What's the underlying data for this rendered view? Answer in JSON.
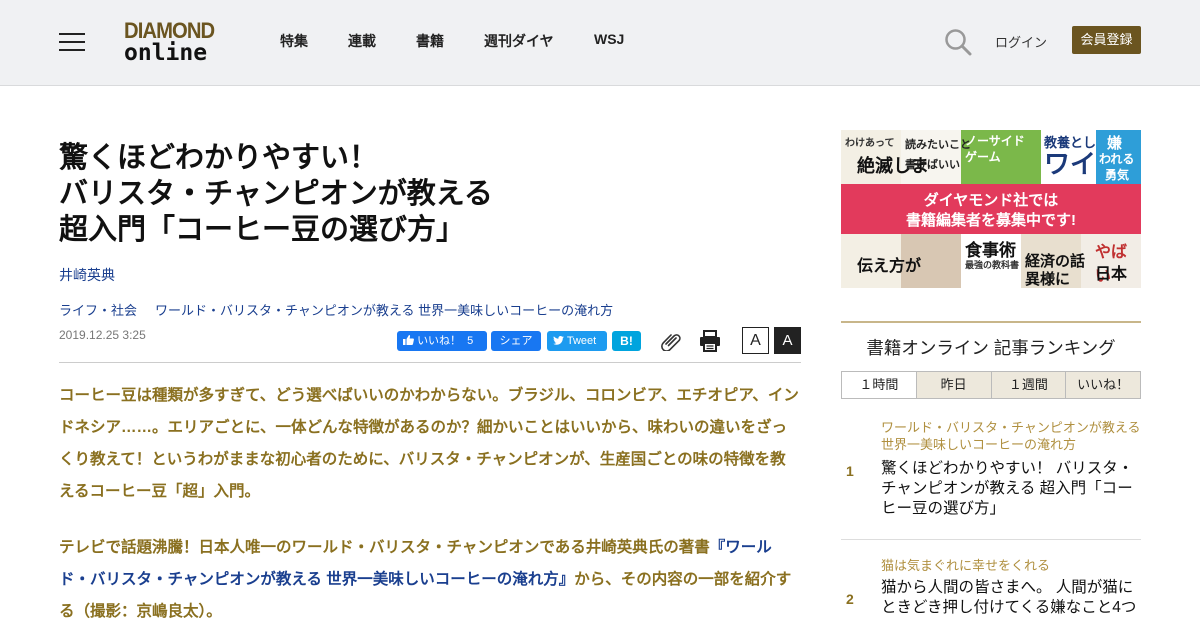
{
  "header": {
    "logo_top": "DIAMOND",
    "logo_bottom": "online",
    "nav": [
      "特集",
      "連載",
      "書籍",
      "週刊ダイヤ",
      "WSJ"
    ],
    "login": "ログイン",
    "register": "会員登録"
  },
  "article": {
    "title_lines": [
      "驚くほどわかりやすい！",
      "バリスタ・チャンピオンが教える",
      "超入門「コーヒー豆の選び方」"
    ],
    "author": "井崎英典",
    "breadcrumb": [
      "ライフ・社会",
      "ワールド・バリスタ・チャンピオンが教える 世界一美味しいコーヒーの淹れ方"
    ],
    "date": "2019.12.25 3:25",
    "share": {
      "like_label": "いいね！",
      "like_count": "5",
      "share_label": "シェア",
      "tweet_label": "Tweet",
      "hatena_label": "B!"
    },
    "font_small": "A",
    "font_large": "A",
    "lead": "コーヒー豆は種類が多すぎて、どう選べばいいのかわからない。ブラジル、コロンビア、エチオピア、インドネシア……。エリアごとに、一体どんな特徴があるのか？細かいことはいいから、味わいの違いをざっくり教えて！というわがままな初心者のために、バリスタ・チャンピオンが、生産国ごとの味の特徴を教えるコーヒー豆「超」入門。",
    "lead2_before": "テレビで話題沸騰！日本人唯一のワールド・バリスタ・チャンピオンである井崎英典氏の著書",
    "lead2_link": "『ワールド・バリスタ・チャンピオンが教える 世界一美味しいコーヒーの淹れ方』",
    "lead2_after": "から、その内容の一部を紹介する（撮影：京嶋良太）。"
  },
  "banner": {
    "line1": "ダイヤモンド社では",
    "line2": "書籍編集者を募集中です!",
    "book_texts": [
      "わけあって",
      "絶滅しま",
      "読みたいこと",
      "書けばいい",
      "ノーサイド",
      "ゲーム",
      "教養とし",
      "ワイ",
      "嫌",
      "われる",
      "勇気",
      "伝え方が",
      "食事術",
      "最強の教科書",
      "経済の話",
      "異様に",
      "やばい",
      "日本史"
    ]
  },
  "ranking": {
    "title": "書籍オンライン 記事ランキング",
    "tabs": [
      "１時間",
      "昨日",
      "１週間",
      "いいね！"
    ],
    "items": [
      {
        "rank": "1",
        "category": "ワールド・バリスタ・チャンピオンが教える 世界一美味しいコーヒーの淹れ方",
        "text": "驚くほどわかりやすい！ バリスタ・チャンピオンが教える 超入門「コーヒー豆の選び方」"
      },
      {
        "rank": "2",
        "category": "猫は気まぐれに幸せをくれる",
        "text": "猫から人間の皆さまへ。 人間が猫にときどき押し付けてくる嫌なこと4つ"
      }
    ]
  },
  "colors": {
    "brand_brown": "#6b5520",
    "lead_gold": "#8a7020",
    "link_blue": "#1a3f8f",
    "facebook_blue": "#1877f2",
    "twitter_blue": "#1d9bf0",
    "hatena_blue": "#00a4de",
    "banner_pink": "#e23a5c"
  },
  "icons": [
    "menu-icon",
    "search-icon",
    "facebook-like-icon",
    "twitter-icon",
    "clip-icon",
    "print-icon"
  ]
}
